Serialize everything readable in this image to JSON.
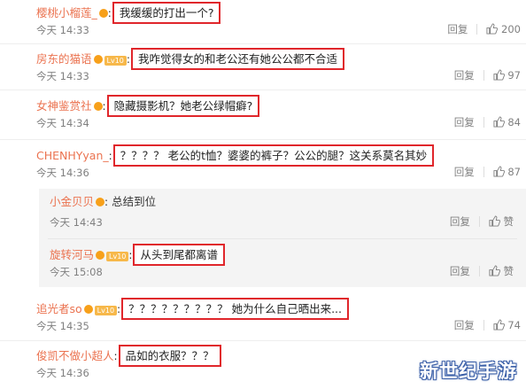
{
  "colors": {
    "username": "#eb7350",
    "highlight_border": "#e0262b",
    "meta": "#808080",
    "reply_bg": "#f4f4f4",
    "vip_badge": "#f7a01a"
  },
  "actions": {
    "reply_label": "回复",
    "like_label_reply": "赞"
  },
  "comments": [
    {
      "user": "樱桃小榴莲_",
      "text": "我缓缓的打出一个?",
      "time": "今天 14:33",
      "likes": "200"
    },
    {
      "user": "房东的猫语",
      "level": "Lv10",
      "text": "我咋觉得女的和老公还有她公公都不合适",
      "time": "今天 14:33",
      "likes": "97"
    },
    {
      "user": "女神鉴赏社",
      "text": "隐藏摄影机？她老公绿帽癖?",
      "time": "今天 14:34",
      "likes": "84"
    },
    {
      "user": "CHENHYyan_",
      "text": "？？？？ 老公的t恤？婆婆的裤子？公公的腿？这关系莫名其妙",
      "time": "今天 14:36",
      "likes": "87"
    },
    {
      "user": "追光者so",
      "level": "Lv10",
      "text": "？？？？？？？？？ 她为什么自己晒出来...",
      "time": "今天 14:35",
      "likes": "74"
    },
    {
      "user": "俊凯不做小超人",
      "text": "品如的衣服？？？",
      "time": "今天 14:36"
    }
  ],
  "replies": [
    {
      "user": "小金贝贝",
      "text": "总结到位",
      "time": "今天 14:43"
    },
    {
      "user": "旋转河马",
      "level": "Lv10",
      "text": "从头到尾都离谱",
      "time": "今天 15:08"
    }
  ],
  "watermark": "新世纪手游"
}
